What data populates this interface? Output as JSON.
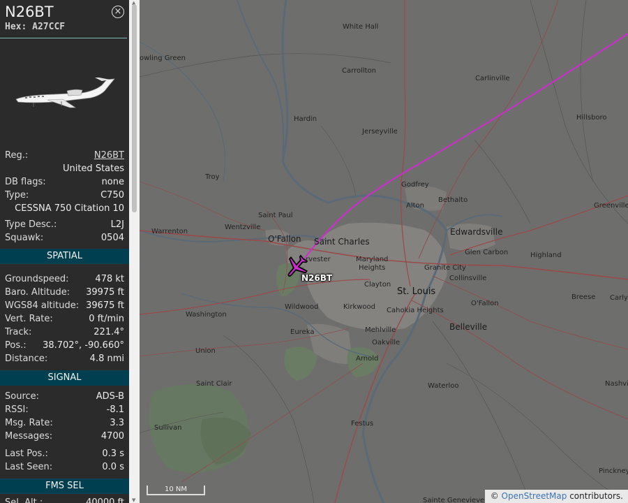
{
  "aircraft": {
    "callsign": "N26BT",
    "hex_label": "Hex:",
    "hex": "A27CCF",
    "close_label": "×"
  },
  "info": [
    {
      "label": "Reg.:",
      "value": "N26BT"
    },
    {
      "label": "",
      "value": "United States"
    },
    {
      "label": "DB flags:",
      "value": "none"
    },
    {
      "label": "Type:",
      "value": "C750"
    },
    {
      "label": "",
      "value": "CESSNA 750 Citation 10"
    },
    {
      "label": "Type Desc.:",
      "value": "L2J"
    },
    {
      "label": "Squawk:",
      "value": "0504"
    }
  ],
  "sections": {
    "spatial": "SPATIAL",
    "signal": "SIGNAL",
    "fms": "FMS SEL"
  },
  "spatial": [
    {
      "label": "Groundspeed:",
      "value": "478 kt"
    },
    {
      "label": "Baro. Altitude:",
      "value": "39975 ft"
    },
    {
      "label": "WGS84 altitude:",
      "value": "39675 ft"
    },
    {
      "label": "Vert. Rate:",
      "value": "0 ft/min"
    },
    {
      "label": "Track:",
      "value": "221.4°"
    },
    {
      "label": "Pos.:",
      "value": "38.702°, -90.660°"
    },
    {
      "label": "Distance:",
      "value": "4.8 nmi"
    }
  ],
  "signal": [
    {
      "label": "Source:",
      "value": "ADS-B"
    },
    {
      "label": "RSSI:",
      "value": "-8.1"
    },
    {
      "label": "Msg. Rate:",
      "value": "3.3"
    },
    {
      "label": "Messages:",
      "value": "4700"
    },
    {
      "label": "Last Pos.:",
      "value": "0.3 s"
    },
    {
      "label": "Last Seen:",
      "value": "0.0 s"
    }
  ],
  "fms": [
    {
      "label": "Sel. Alt.:",
      "value": "40000 ft"
    }
  ],
  "map": {
    "aircraft_label": "N26BT",
    "scale": "10 NM",
    "attribution_prefix": "© ",
    "attribution_link": "OpenStreetMap",
    "attribution_suffix": " contributors.",
    "track_color": "#d22ad2",
    "places": {
      "white_hall": "White Hall",
      "bowling_green": "owling Green",
      "carrollton": "Carrollton",
      "carlinville": "Carlinville",
      "hardin": "Hardin",
      "hillsboro": "Hillsboro",
      "jerseyville": "Jerseyville",
      "troy": "Troy",
      "godfrey": "Godfrey",
      "bethalto": "Bethalto",
      "alton": "Alton",
      "greenville": "Greenville",
      "saint_paul": "Saint Paul",
      "warrenton": "Warrenton",
      "wentzville": "Wentzville",
      "ofallon_mo": "O'Fallon",
      "saint_charles": "Saint Charles",
      "edwardsville": "Edwardsville",
      "maryland": "Maryland",
      "heights": "Heights",
      "glen_carbon": "Glen Carbon",
      "highland": "Highland",
      "chesterfield": "rvester",
      "granite_city": "Granite City",
      "collinsville": "Collinsville",
      "clayton": "Clayton",
      "st_louis": "St. Louis",
      "breese": "Breese",
      "carlyle": "Carly",
      "washington": "Washington",
      "wildwood": "Wildwood",
      "kirkwood": "Kirkwood",
      "cahokia": "Cahokia Heights",
      "ofallon_il": "O'Fallon",
      "belleville": "Belleville",
      "eureka": "Eureka",
      "mehlville": "Mehlville",
      "union": "Union",
      "oakville": "Oakville",
      "arnold": "Arnold",
      "saint_clair": "Saint Clair",
      "waterloo": "Waterloo",
      "nashville": "Nashvil",
      "sullivan": "Sullivan",
      "festus": "Festus",
      "pinckney": "Pinckney",
      "ste_gen": "Sainte Genevieve",
      "sparta": "S",
      "field": "ld"
    }
  }
}
